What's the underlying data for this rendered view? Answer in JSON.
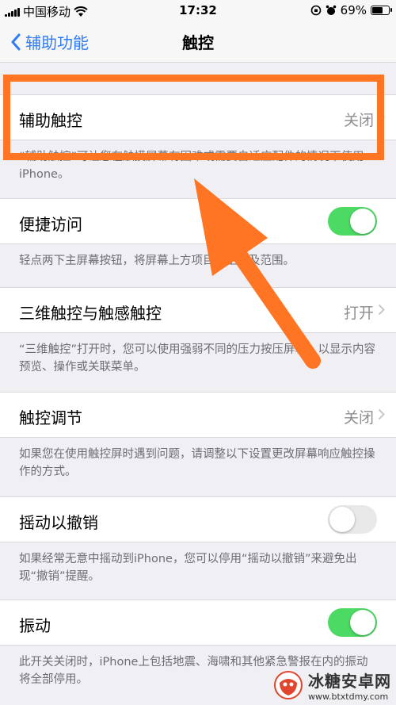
{
  "status_bar": {
    "carrier": "中国移动",
    "time": "17:32",
    "battery": "69%",
    "battery_level": 0.69
  },
  "nav": {
    "back_label": "辅助功能",
    "title": "触控"
  },
  "sections": [
    {
      "label": "辅助触控",
      "value": "关闭",
      "footer": "“辅助触控”可让您在触摸屏幕有困难或需要自适应配件的情况下使用iPhone。"
    },
    {
      "label": "便捷访问",
      "toggle": "on",
      "footer": "轻点两下主屏幕按钮，将屏幕上方项目移至可及范围。"
    },
    {
      "label": "三维触控与触感触控",
      "value": "打开",
      "footer": "“三维触控”打开时，您可以使用强弱不同的压力按压屏幕，以显示内容预览、操作或关联菜单。"
    },
    {
      "label": "触控调节",
      "value": "关闭",
      "footer": "如果您在使用触控屏时遇到问题，请调整以下设置更改屏幕响应触控操作的方式。"
    },
    {
      "label": "摇动以撤销",
      "toggle": "off",
      "footer": "如果经常无意中摇动到iPhone，您可以停用“摇动以撤销”来避免出现“撤销”提醒。"
    },
    {
      "label": "振动",
      "toggle": "on",
      "footer": "此开关关闭时，iPhone上包括地震、海啸和其他紧急警报在内的振动将全部停用。"
    }
  ],
  "watermark": {
    "title": "冰糖安卓网",
    "url": "www.btxtdmy.com"
  },
  "colors": {
    "accent_blue": "#2f7cf6",
    "toggle_on": "#4cd964",
    "annotation_orange": "#ff7524"
  }
}
